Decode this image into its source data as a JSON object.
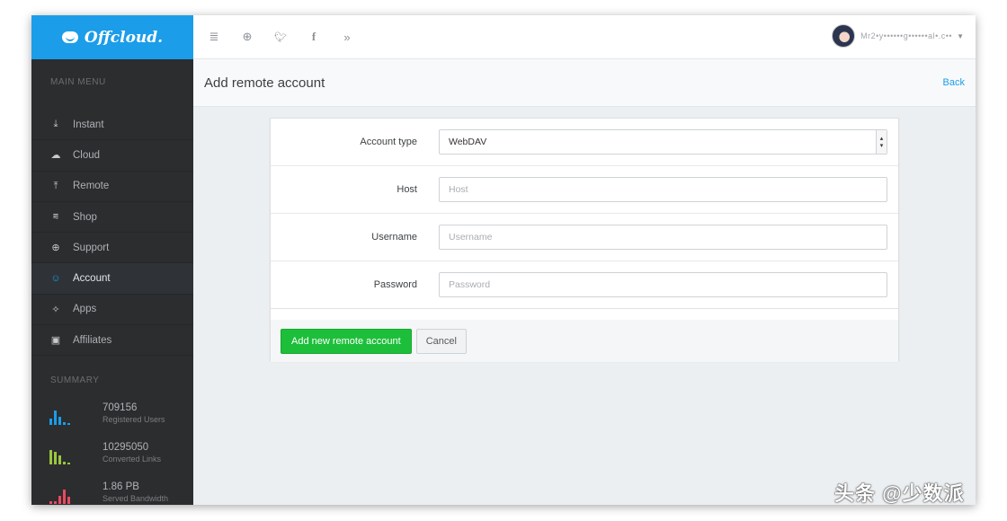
{
  "brand": {
    "name": "Offcloud."
  },
  "sidebar": {
    "menu_heading": "MAIN MENU",
    "items": [
      {
        "label": "Instant",
        "icon": "download-tray-icon"
      },
      {
        "label": "Cloud",
        "icon": "cloud-icon"
      },
      {
        "label": "Remote",
        "icon": "upload-tray-icon"
      },
      {
        "label": "Shop",
        "icon": "cart-icon"
      },
      {
        "label": "Support",
        "icon": "lifebuoy-icon"
      },
      {
        "label": "Account",
        "icon": "users-icon",
        "active": true
      },
      {
        "label": "Apps",
        "icon": "wand-icon"
      },
      {
        "label": "Affiliates",
        "icon": "money-icon"
      }
    ],
    "summary_heading": "SUMMARY",
    "stats": [
      {
        "value": "709156",
        "label": "Registered Users",
        "color": "#1b9de9"
      },
      {
        "value": "10295050",
        "label": "Converted Links",
        "color": "#9bc53d"
      },
      {
        "value": "1.86 PB",
        "label": "Served Bandwidth",
        "color": "#e84a5f"
      }
    ]
  },
  "topbar": {
    "icons": [
      "menu-indent-icon",
      "globe-icon",
      "twitter-icon",
      "facebook-icon",
      "chevron-right-icon"
    ],
    "user_name": "Mr2•y••••••g••••••al•.c••"
  },
  "page": {
    "title": "Add remote account",
    "back_label": "Back"
  },
  "form": {
    "account_type_label": "Account type",
    "account_type_value": "WebDAV",
    "host_label": "Host",
    "host_placeholder": "Host",
    "username_label": "Username",
    "username_placeholder": "Username",
    "password_label": "Password",
    "password_placeholder": "Password",
    "submit_label": "Add new remote account",
    "cancel_label": "Cancel"
  },
  "watermark": "头条 @少数派",
  "colors": {
    "brand_blue": "#1b9de9",
    "sidebar_bg": "#2b2d2f",
    "primary_green": "#1dbf3a"
  }
}
